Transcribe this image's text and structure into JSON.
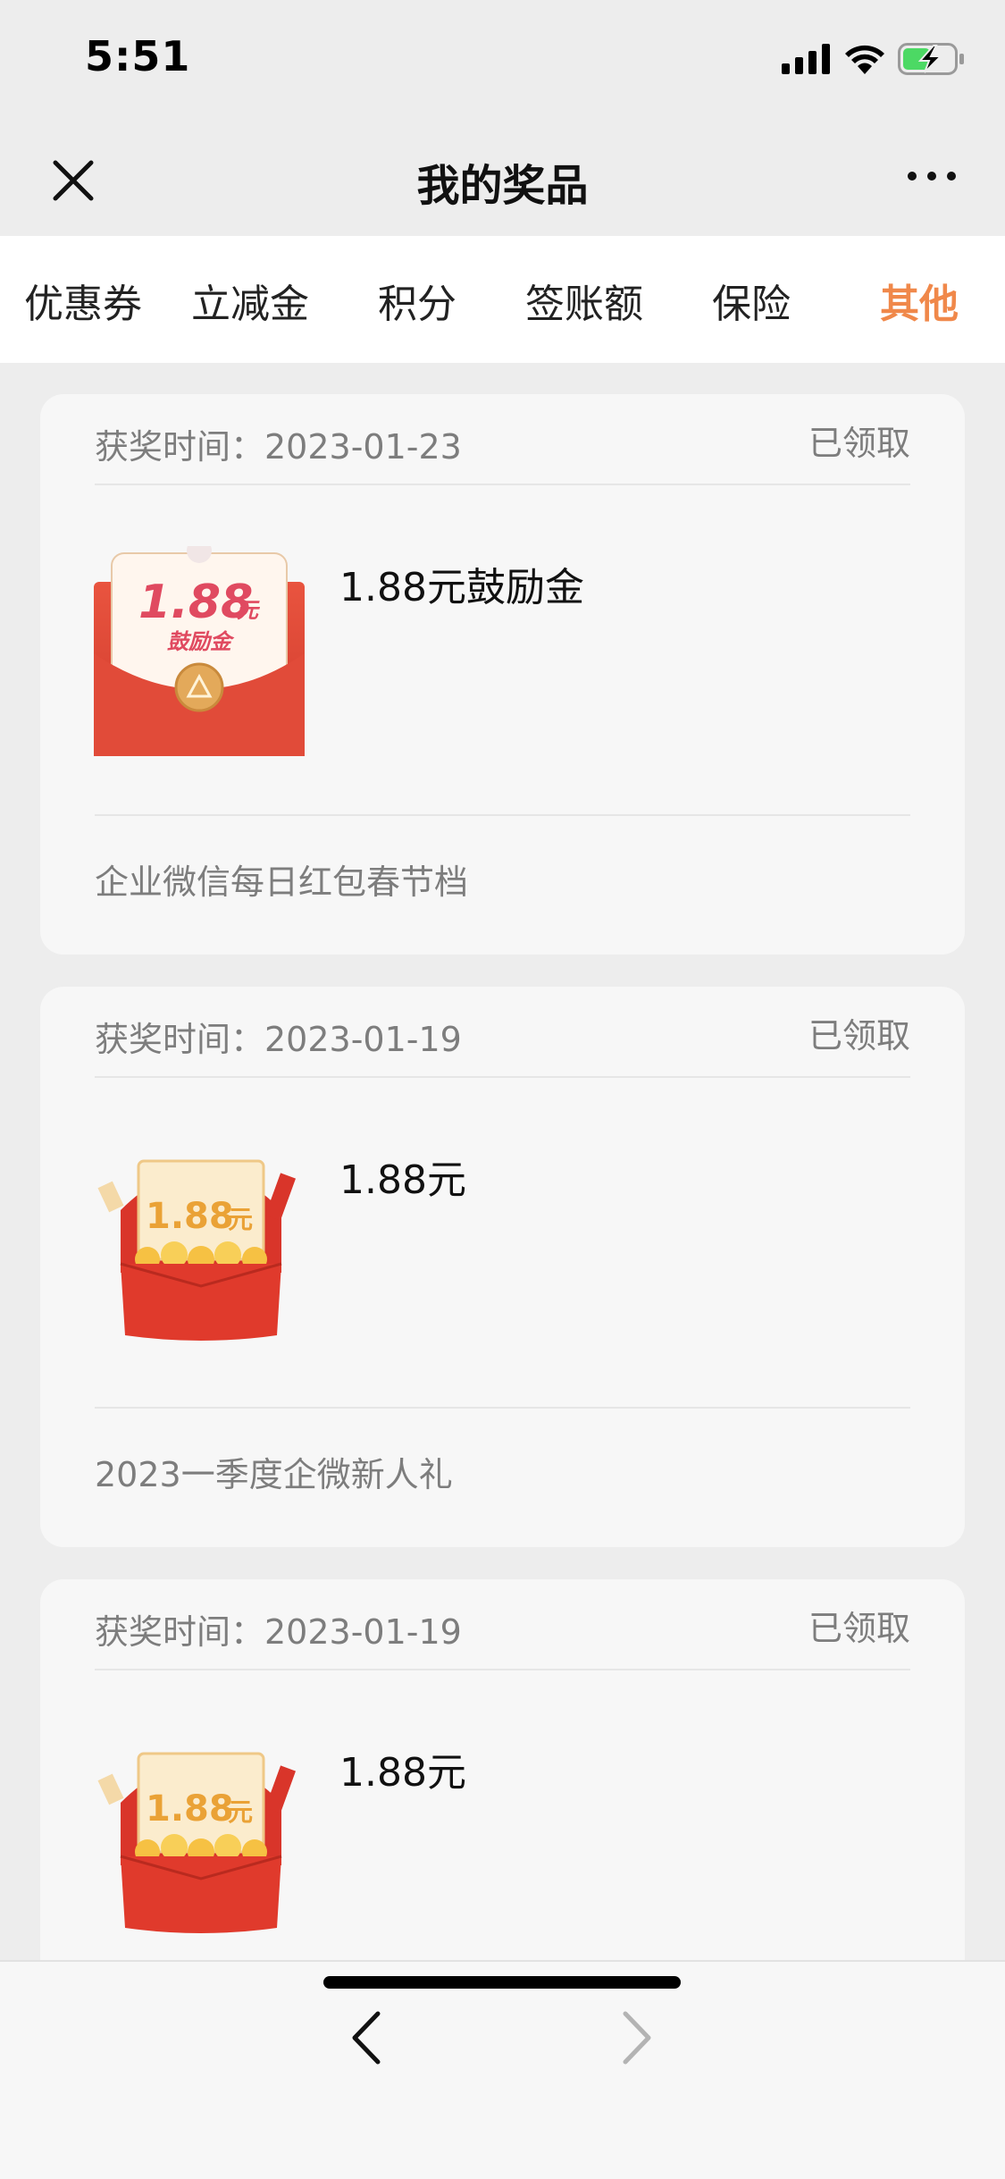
{
  "status_bar": {
    "time": "5:51"
  },
  "header": {
    "title": "我的奖品",
    "close_icon": "close-icon",
    "more_icon": "more-icon"
  },
  "tabs": [
    {
      "label": "优惠券",
      "active": false
    },
    {
      "label": "立减金",
      "active": false
    },
    {
      "label": "积分",
      "active": false
    },
    {
      "label": "签账额",
      "active": false
    },
    {
      "label": "保险",
      "active": false
    },
    {
      "label": "其他",
      "active": true
    }
  ],
  "accent_color": "#f0884a",
  "cards": [
    {
      "date": "获奖时间：2023-01-23",
      "status": "已领取",
      "prize_name": "1.88元鼓励金",
      "image": {
        "type": "incentive-envelope",
        "amount": "1.88",
        "unit": "元",
        "caption": "鼓励金"
      },
      "source": "企业微信每日红包春节档"
    },
    {
      "date": "获奖时间：2023-01-19",
      "status": "已领取",
      "prize_name": "1.88元",
      "image": {
        "type": "coin-envelope",
        "amount": "1.88",
        "unit": "元"
      },
      "source": "2023一季度企微新人礼"
    },
    {
      "date": "获奖时间：2023-01-19",
      "status": "已领取",
      "prize_name": "1.88元",
      "image": {
        "type": "coin-envelope",
        "amount": "1.88",
        "unit": "元"
      },
      "source": ""
    }
  ],
  "bottom_bar": {
    "back_icon": "chevron-left-icon",
    "forward_icon": "chevron-right-icon",
    "forward_enabled": false
  }
}
